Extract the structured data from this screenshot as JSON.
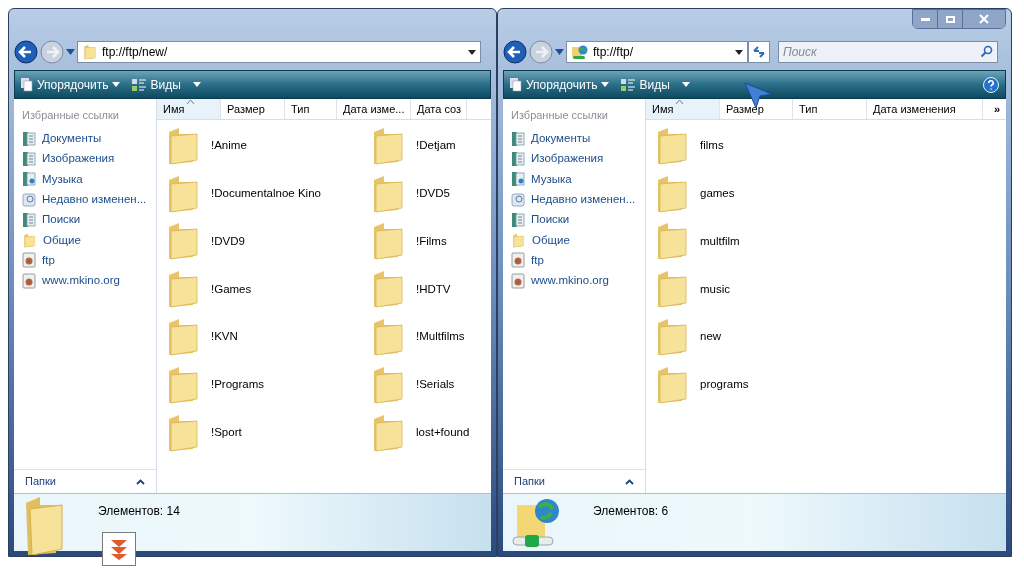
{
  "windows": [
    {
      "address": {
        "text": "ftp://ftp/new/",
        "kind": "folder"
      },
      "caption_buttons": false,
      "refresh": false,
      "toolbar": {
        "organize": "Упорядочить",
        "views": "Виды",
        "help": false
      },
      "columns": [
        {
          "label": "Имя",
          "sorted": true
        },
        {
          "label": "Размер",
          "sorted": false
        },
        {
          "label": "Тип",
          "sorted": false
        },
        {
          "label": "Дата изме...",
          "sorted": false
        },
        {
          "label": "Дата соз",
          "sorted": false
        }
      ],
      "favorites_title": "Избранные ссылки",
      "favorites": [
        {
          "label": "Документы",
          "kind": "documents"
        },
        {
          "label": "Изображения",
          "kind": "pictures"
        },
        {
          "label": "Музыка",
          "kind": "music"
        },
        {
          "label": "Недавно изменен...",
          "kind": "recent"
        },
        {
          "label": "Поиски",
          "kind": "searches"
        },
        {
          "label": "Общие",
          "kind": "folder"
        },
        {
          "label": "ftp",
          "kind": "web"
        },
        {
          "label": "www.mkino.org",
          "kind": "web"
        }
      ],
      "folders_label": "Папки",
      "items": [
        "!Anime",
        "!Documentalnoe Kino",
        "!DVD9",
        "!Games",
        "!KVN",
        "!Programs",
        "!Sport",
        "!Detjam",
        "!DVD5",
        "!Films",
        "!HDTV",
        "!Multfilms",
        "!Serials",
        "lost+found"
      ],
      "status": {
        "text": "Элементов: 14",
        "kind": "folder"
      },
      "overlay_button": true
    },
    {
      "address": {
        "text": "ftp://ftp/",
        "kind": "ftp"
      },
      "caption_buttons": true,
      "refresh": true,
      "search": {
        "placeholder": "Поиск"
      },
      "toolbar": {
        "organize": "Упорядочить",
        "views": "Виды",
        "help": true
      },
      "columns": [
        {
          "label": "Имя",
          "sorted": true
        },
        {
          "label": "Размер",
          "sorted": false
        },
        {
          "label": "Тип",
          "sorted": false
        },
        {
          "label": "Дата изменения",
          "sorted": false
        }
      ],
      "more_columns": "»",
      "favorites_title": "Избранные ссылки",
      "favorites": [
        {
          "label": "Документы",
          "kind": "documents"
        },
        {
          "label": "Изображения",
          "kind": "pictures"
        },
        {
          "label": "Музыка",
          "kind": "music"
        },
        {
          "label": "Недавно изменен...",
          "kind": "recent"
        },
        {
          "label": "Поиски",
          "kind": "searches"
        },
        {
          "label": "Общие",
          "kind": "folder"
        },
        {
          "label": "ftp",
          "kind": "web"
        },
        {
          "label": "www.mkino.org",
          "kind": "web"
        }
      ],
      "folders_label": "Папки",
      "items": [
        "films",
        "games",
        "multfilm",
        "music",
        "new",
        "programs"
      ],
      "status": {
        "text": "Элементов: 6",
        "kind": "ftp"
      },
      "overlay_button": false,
      "cursor": true
    }
  ]
}
